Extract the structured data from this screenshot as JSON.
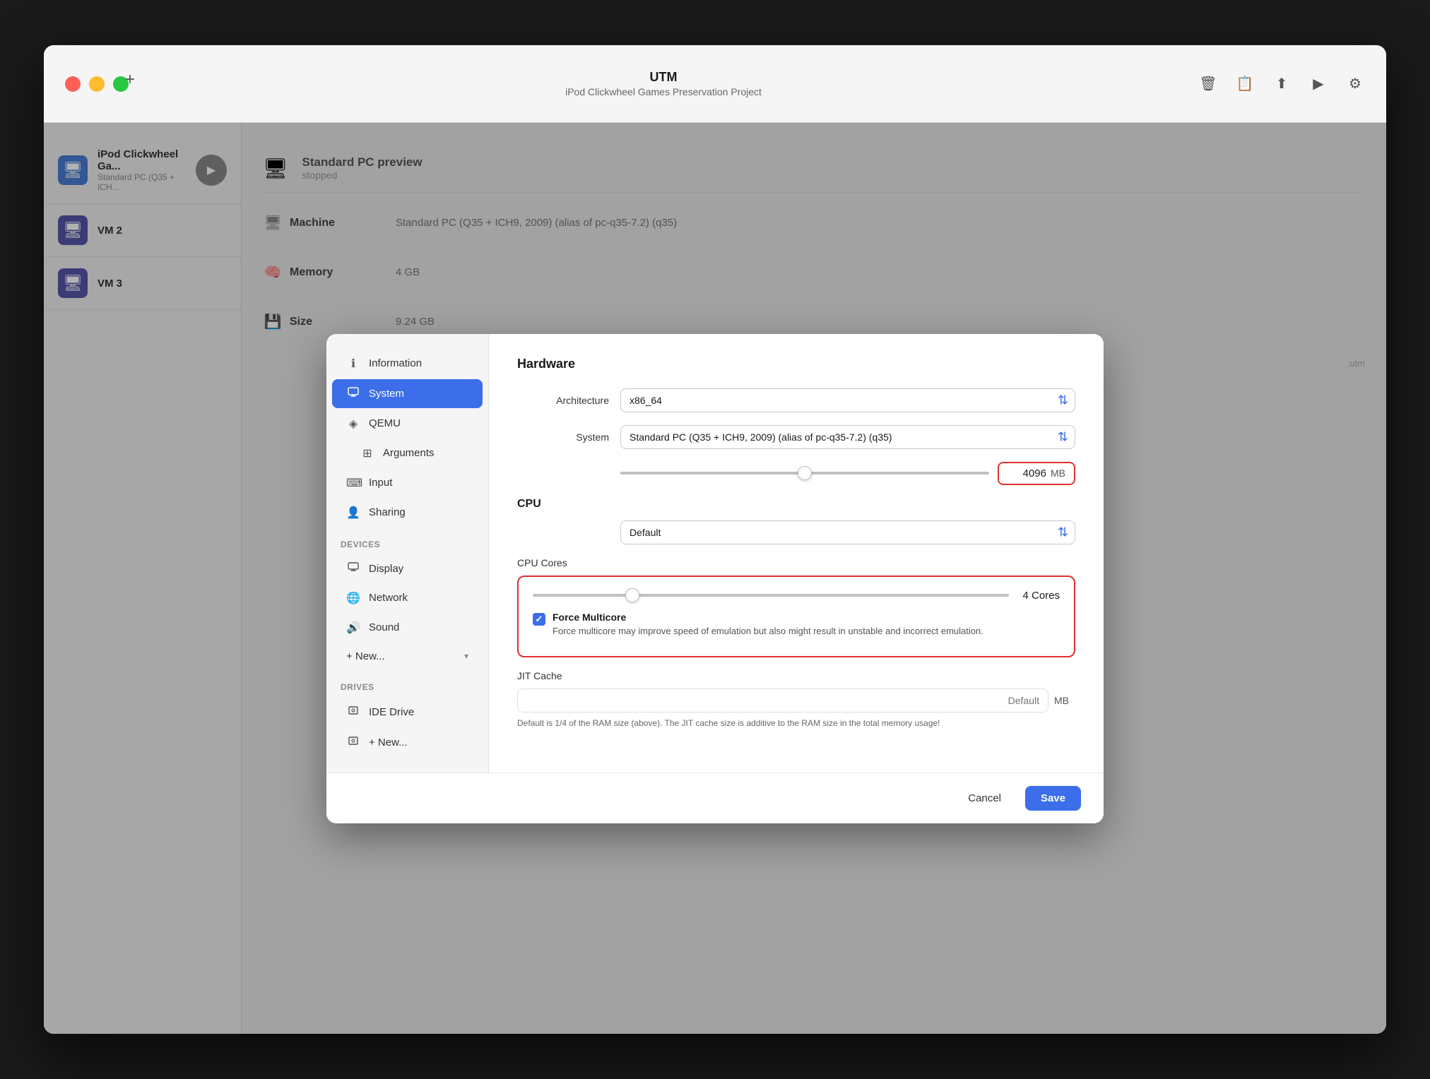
{
  "app": {
    "title": "UTM",
    "subtitle": "iPod Clickwheel Games Preservation Project",
    "window_controls": {
      "close": "close",
      "minimize": "minimize",
      "maximize": "maximize"
    }
  },
  "sidebar": {
    "vm_name": "iPod Clickwheel Ga...",
    "vm_desc": "Standard PC (Q35 + ICH...",
    "items": [
      {
        "id": "information",
        "label": "Information",
        "icon": "ℹ"
      },
      {
        "id": "system",
        "label": "System",
        "icon": "🖥",
        "active": true
      },
      {
        "id": "qemu",
        "label": "QEMU",
        "icon": "◈"
      },
      {
        "id": "arguments",
        "label": "Arguments",
        "icon": "⊞",
        "sub": true
      },
      {
        "id": "input",
        "label": "Input",
        "icon": "⌨"
      },
      {
        "id": "sharing",
        "label": "Sharing",
        "icon": "👤"
      }
    ],
    "devices_section": "Devices",
    "devices": [
      {
        "id": "display",
        "label": "Display",
        "icon": "🖥"
      },
      {
        "id": "network",
        "label": "Network",
        "icon": "🌐"
      },
      {
        "id": "sound",
        "label": "Sound",
        "icon": "🔊"
      },
      {
        "id": "new_device",
        "label": "+ New...",
        "has_chevron": true
      }
    ],
    "drives_section": "Drives",
    "drives": [
      {
        "id": "ide_drive",
        "label": "IDE Drive",
        "icon": "💾"
      },
      {
        "id": "new_drive",
        "label": "+ New...",
        "icon": "💾"
      }
    ]
  },
  "hardware": {
    "section_title": "Hardware",
    "architecture_label": "Architecture",
    "architecture_value": "x86_64",
    "system_label": "System",
    "system_value": "Standard PC (Q35 + ICH9, 2009) (alias of pc-q35-7.2) (q35)",
    "ram_value": "4096",
    "ram_unit": "MB",
    "cpu_section": "CPU",
    "cpu_value": "Default",
    "cpu_cores_label": "CPU Cores",
    "cores_value": "4",
    "cores_unit": "Cores",
    "force_multicore_label": "Force Multicore",
    "force_multicore_desc": "Force multicore may improve speed of emulation but also might result in unstable and incorrect emulation.",
    "jit_cache_label": "JIT Cache",
    "jit_placeholder": "Default",
    "jit_unit": "MB",
    "jit_desc": "Default is 1/4 of the RAM size (above). The JIT cache size is additive to the RAM size in the total memory usage!"
  },
  "footer": {
    "cancel_label": "Cancel",
    "save_label": "Save"
  },
  "background": {
    "machine_label": "Machine",
    "machine_value": "Standard PC (Q35 + ICH9, 2009) (alias of pc-q35-7.2) (q35)",
    "memory_label": "Memory",
    "memory_value": "4 GB",
    "size_label": "Size",
    "size_value": "9.24 GB",
    "stopped_text": "stopped",
    "utm_text": ".utm"
  }
}
